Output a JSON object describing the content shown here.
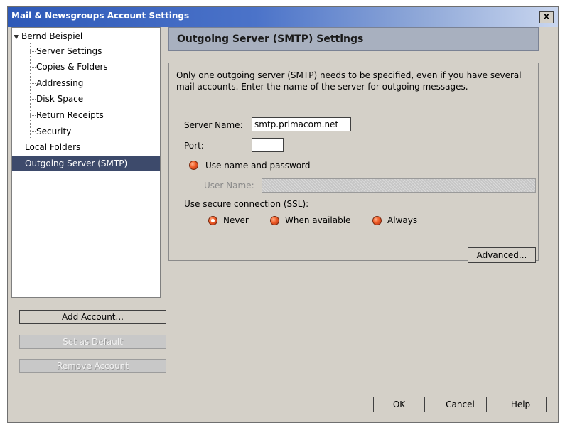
{
  "window": {
    "title": "Mail & Newsgroups Account Settings",
    "close_label": "x"
  },
  "tree": {
    "account": "Bernd Beispiel",
    "children": [
      "Server Settings",
      "Copies & Folders",
      "Addressing",
      "Disk Space",
      "Return Receipts",
      "Security"
    ],
    "local_folders": "Local Folders",
    "outgoing_server": "Outgoing Server (SMTP)",
    "expand_icon": "triangle-down"
  },
  "left_buttons": {
    "add_account": "Add Account...",
    "set_default": "Set as Default",
    "remove_account": "Remove Account"
  },
  "panel": {
    "title": "Outgoing Server (SMTP) Settings",
    "description": "Only one outgoing server (SMTP) needs to be specified, even if you have several mail accounts. Enter the name of the server for outgoing messages.",
    "server_name_label": "Server Name:",
    "server_name_value": "smtp.primacom.net",
    "port_label": "Port:",
    "port_value": "",
    "use_name_password_label": "Use name and password",
    "user_name_label": "User Name:",
    "user_name_value": "",
    "ssl_label": "Use secure connection (SSL):",
    "ssl_options": [
      "Never",
      "When available",
      "Always"
    ],
    "ssl_selected": "Never",
    "advanced_button": "Advanced..."
  },
  "footer": {
    "ok": "OK",
    "cancel": "Cancel",
    "help": "Help"
  },
  "colors": {
    "titlebar": "#2e59b8",
    "selected_item": "#3d4a6b",
    "header_bg": "#a8b0bf",
    "radio_accent": "#ef5a24"
  }
}
